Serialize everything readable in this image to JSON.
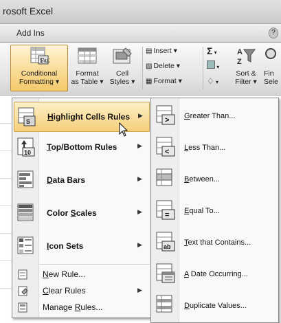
{
  "window": {
    "title": "rosoft Excel"
  },
  "tabs": {
    "addins": "Add Ins"
  },
  "ribbon": {
    "conditional_formatting": {
      "line1": "Conditional",
      "line2": "Formatting ▾"
    },
    "format_as_table": {
      "line1": "Format",
      "line2": "as Table ▾"
    },
    "cell_styles": {
      "line1": "Cell",
      "line2": "Styles ▾"
    },
    "insert": "Insert ▾",
    "delete": "Delete ▾",
    "format": "Format ▾",
    "sort_filter": {
      "line1": "Sort &",
      "line2": "Filter ▾"
    },
    "find_select": {
      "line1": "Fin",
      "line2": "Sele"
    }
  },
  "menu": {
    "items": [
      {
        "pre": "",
        "acc": "H",
        "post": "ighlight Cells Rules",
        "icon": "highlight-cells-icon"
      },
      {
        "pre": "",
        "acc": "T",
        "post": "op/Bottom Rules",
        "icon": "top-bottom-icon"
      },
      {
        "pre": "",
        "acc": "D",
        "post": "ata Bars",
        "icon": "data-bars-icon"
      },
      {
        "pre": "Color ",
        "acc": "S",
        "post": "cales",
        "icon": "color-scales-icon"
      },
      {
        "pre": "",
        "acc": "I",
        "post": "con Sets",
        "icon": "icon-sets-icon"
      }
    ],
    "small": [
      {
        "pre": "",
        "acc": "N",
        "post": "ew Rule...",
        "icon": "new-rule-icon"
      },
      {
        "pre": "",
        "acc": "C",
        "post": "lear Rules",
        "icon": "clear-rules-icon"
      },
      {
        "pre": "Manage ",
        "acc": "R",
        "post": "ules...",
        "icon": "manage-rules-icon"
      }
    ]
  },
  "submenu": {
    "items": [
      {
        "pre": "",
        "acc": "G",
        "post": "reater Than...",
        "icon": "greater-than-icon"
      },
      {
        "pre": "",
        "acc": "L",
        "post": "ess Than...",
        "icon": "less-than-icon"
      },
      {
        "pre": "",
        "acc": "B",
        "post": "etween...",
        "icon": "between-icon"
      },
      {
        "pre": "",
        "acc": "E",
        "post": "qual To...",
        "icon": "equal-to-icon"
      },
      {
        "pre": "",
        "acc": "T",
        "post": "ext that Contains...",
        "icon": "text-contains-icon"
      },
      {
        "pre": "",
        "acc": "A",
        "post": " Date Occurring...",
        "icon": "date-occurring-icon"
      },
      {
        "pre": "",
        "acc": "D",
        "post": "uplicate Values...",
        "icon": "duplicate-values-icon"
      }
    ]
  }
}
